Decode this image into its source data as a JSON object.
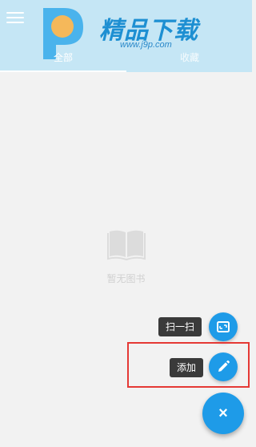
{
  "watermark": {
    "title": "精品下载",
    "url": "www.j9p.com",
    "letter": "P"
  },
  "appbar": {
    "menu_icon": "menu-icon",
    "tabs": [
      {
        "label": "全部",
        "selected": true
      },
      {
        "label": "收藏",
        "selected": false
      }
    ]
  },
  "empty_state": {
    "icon": "book-icon",
    "text": "暂无图书"
  },
  "fab": {
    "actions": [
      {
        "label": "扫一扫",
        "icon": "scan-icon"
      },
      {
        "label": "添加",
        "icon": "pencil-icon"
      }
    ],
    "main_icon": "close-icon",
    "main_symbol": "×"
  },
  "colors": {
    "appbar": "#c5e6f5",
    "accent": "#1e9be8",
    "highlight": "#e53935",
    "background": "#f2f2f2"
  }
}
